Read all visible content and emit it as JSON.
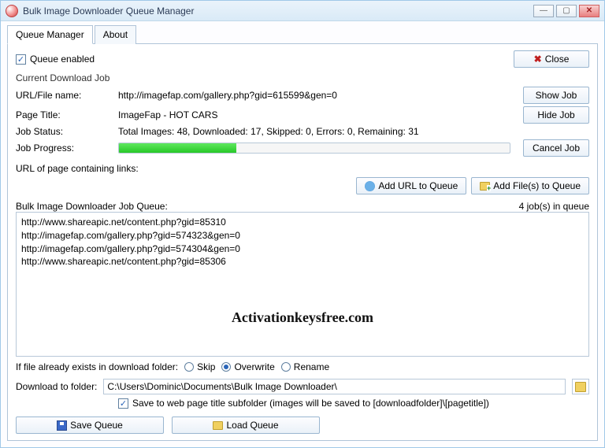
{
  "window": {
    "title": "Bulk Image Downloader Queue Manager"
  },
  "tabs": {
    "queue": "Queue Manager",
    "about": "About"
  },
  "queue_enabled": "Queue enabled",
  "close_btn": "Close",
  "section_current": "Current Download Job",
  "labels": {
    "url": "URL/File name:",
    "page_title": "Page Title:",
    "status": "Job Status:",
    "progress": "Job Progress:"
  },
  "job": {
    "url": "http://imagefap.com/gallery.php?gid=615599&gen=0",
    "page_title": "ImageFap - HOT CARS",
    "status": "Total Images: 48, Downloaded: 17, Skipped: 0, Errors: 0, Remaining: 31"
  },
  "btns": {
    "show": "Show Job",
    "hide": "Hide Job",
    "cancel": "Cancel Job",
    "add_url": "Add URL to Queue",
    "add_files": "Add File(s) to Queue",
    "save_queue": "Save Queue",
    "load_queue": "Load Queue"
  },
  "url_links_label": "URL of page containing links:",
  "queue_label": "Bulk Image Downloader Job Queue:",
  "queue_count": "4 job(s) in queue",
  "queue_items": {
    "i0": "http://www.shareapic.net/content.php?gid=85310",
    "i1": "http://imagefap.com/gallery.php?gid=574323&gen=0",
    "i2": "http://imagefap.com/gallery.php?gid=574304&gen=0",
    "i3": "http://www.shareapic.net/content.php?gid=85306"
  },
  "exists_label": "If file already exists in download folder:",
  "exists_opts": {
    "skip": "Skip",
    "overwrite": "Overwrite",
    "rename": "Rename"
  },
  "folder_label": "Download to folder:",
  "folder_path": "C:\\Users\\Dominic\\Documents\\Bulk Image Downloader\\",
  "subfolder_label": "Save to web page title subfolder (images will be saved to [downloadfolder]\\[pagetitle])",
  "watermark": "Activationkeysfree.com"
}
